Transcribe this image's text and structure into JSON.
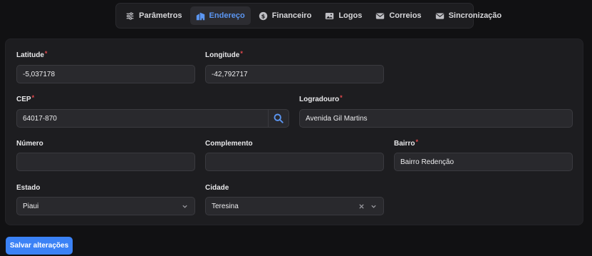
{
  "tabs": [
    {
      "label": "Parâmetros",
      "icon": "sliders-icon"
    },
    {
      "label": "Endereço",
      "icon": "building-icon"
    },
    {
      "label": "Financeiro",
      "icon": "dollar-circle-icon"
    },
    {
      "label": "Logos",
      "icon": "image-icon"
    },
    {
      "label": "Correios",
      "icon": "envelope-icon"
    },
    {
      "label": "Sincronização",
      "icon": "envelope-icon"
    }
  ],
  "active_tab": "Endereço",
  "form": {
    "latitude": {
      "label": "Latitude",
      "value": "-5,037178",
      "required": "*"
    },
    "longitude": {
      "label": "Longitude",
      "value": "-42,792717",
      "required": "*"
    },
    "cep": {
      "label": "CEP",
      "value": "64017-870",
      "required": "*"
    },
    "logradouro": {
      "label": "Logradouro",
      "value": "Avenida Gil Martins",
      "required": "*"
    },
    "numero": {
      "label": "Número",
      "value": ""
    },
    "complemento": {
      "label": "Complemento",
      "value": ""
    },
    "bairro": {
      "label": "Bairro",
      "value": "Bairro Redenção",
      "required": "*"
    },
    "estado": {
      "label": "Estado",
      "value": "Piaui"
    },
    "cidade": {
      "label": "Cidade",
      "value": "Teresina"
    }
  },
  "save_label": "Salvar alterações",
  "colors": {
    "accent": "#3b82f6",
    "active_tab": "#5b96f2",
    "required": "#e5484d",
    "background": "#111113",
    "card": "#1d1d20"
  }
}
